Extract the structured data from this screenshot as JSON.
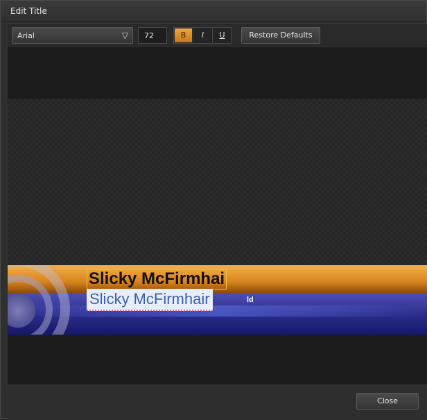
{
  "window": {
    "title": "Edit Title"
  },
  "toolbar": {
    "font_family": "Arial",
    "font_size": "72",
    "bold_label": "B",
    "italic_label": "I",
    "underline_label": "U",
    "restore_label": "Restore Defaults",
    "chevron_icon": "chevron-down-icon"
  },
  "preview": {
    "line1": "Slicky McFirmhai",
    "line2": "Slicky McFirmhair",
    "line2_tail": "ld"
  },
  "footer": {
    "close_label": "Close"
  },
  "colors": {
    "accent": "#f2a640",
    "orange_bar": "#d8831c",
    "purple_bar": "#2a2b86"
  }
}
